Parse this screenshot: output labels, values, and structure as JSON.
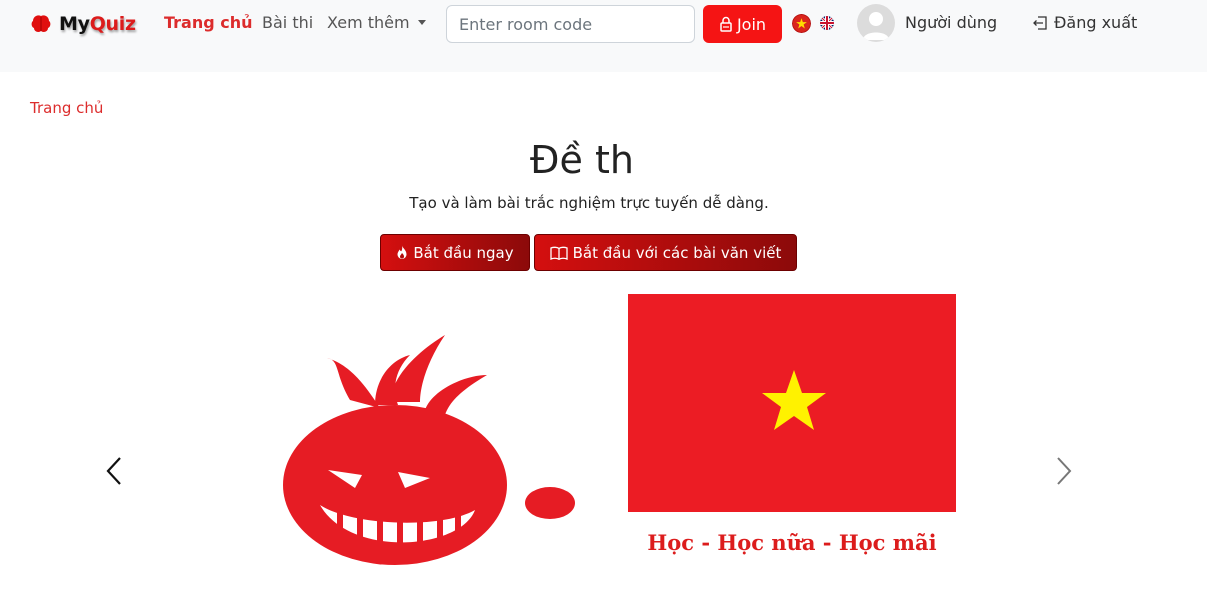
{
  "brand": {
    "my": "My",
    "quiz": "Quiz"
  },
  "nav": {
    "home": "Trang chủ",
    "exams": "Bài thi",
    "more": "Xem thêm"
  },
  "room": {
    "placeholder": "Enter room code",
    "join_label": "Join"
  },
  "user": {
    "name": "Người dùng",
    "logout_label": "Đăng xuất"
  },
  "breadcrumb": {
    "home": "Trang chủ"
  },
  "hero": {
    "title": "Đề th",
    "subtitle": "Tạo và làm bài trắc nghiệm trực tuyến dễ dàng.",
    "start_label": "Bắt đầu ngay",
    "essay_label": "Bắt đầu với các bài văn viết"
  },
  "carousel": {
    "motto": "Học - Học nữa - Học mãi"
  },
  "colors": {
    "accent": "#dc2c2c",
    "join": "#f51414",
    "flag_red": "#ec1c24",
    "star": "#fff200"
  },
  "icons": [
    "brain-icon",
    "lock-icon",
    "vn-flag-icon",
    "uk-flag-icon",
    "user-icon",
    "logout-icon",
    "fire-icon",
    "book-icon",
    "chevron-left-icon",
    "chevron-right-icon"
  ]
}
